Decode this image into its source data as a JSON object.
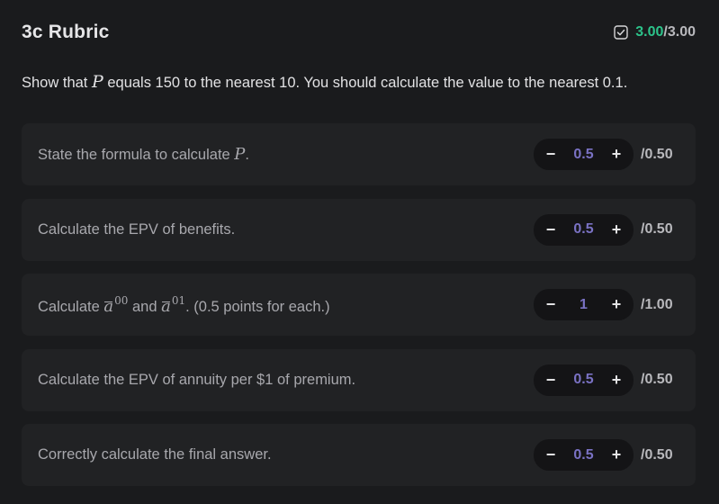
{
  "header": {
    "title": "3c Rubric",
    "score_earned": "3.00",
    "score_total": "/3.00",
    "accent_color": "#2cc38a"
  },
  "prompt": {
    "before": "Show that ",
    "variable": "P",
    "after": " equals 150 to the nearest 10. You should calculate the value to the nearest 0.1."
  },
  "items": [
    {
      "text_before": "State the formula to calculate ",
      "variable": "P",
      "text_after": ".",
      "value": "0.5",
      "max": "/0.50",
      "minus_label": "−",
      "plus_label": "+"
    },
    {
      "text": "Calculate the EPV of benefits.",
      "value": "0.5",
      "max": "/0.50",
      "minus_label": "−",
      "plus_label": "+"
    },
    {
      "text_before": "Calculate ",
      "symbol_1": "a",
      "sup_1": "00",
      "text_mid": " and ",
      "symbol_2": "a",
      "sup_2": "01",
      "text_after": ". (0.5 points for each.)",
      "value": "1",
      "max": "/1.00",
      "minus_label": "−",
      "plus_label": "+"
    },
    {
      "text": "Calculate the EPV of annuity per $1 of premium.",
      "value": "0.5",
      "max": "/0.50",
      "minus_label": "−",
      "plus_label": "+"
    },
    {
      "text": "Correctly calculate the final answer.",
      "value": "0.5",
      "max": "/0.50",
      "minus_label": "−",
      "plus_label": "+"
    }
  ],
  "icons": {
    "score_icon": "checkbox-checked-icon"
  },
  "colors": {
    "value": "#7a72c4",
    "card": "#212224",
    "background": "#1a1b1d"
  }
}
